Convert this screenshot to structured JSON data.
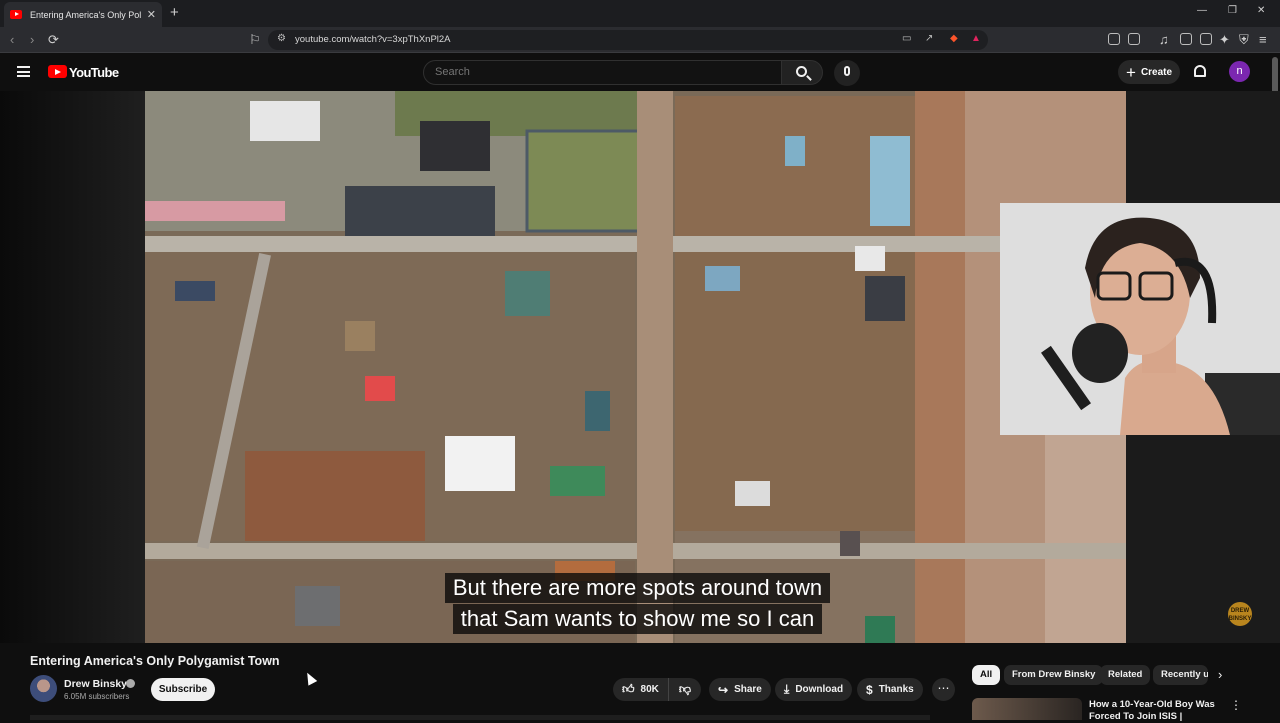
{
  "browser": {
    "tab_title": "Entering America's Only Polygamist Town",
    "tab_close": "✕",
    "new_tab": "+",
    "url": "youtube.com/watch?v=3xpThXnPl2A",
    "window_controls": [
      "—",
      "❐",
      "✕"
    ]
  },
  "masthead": {
    "logo_text": "YouTube",
    "search_placeholder": "Search",
    "create_label": "Create",
    "avatar_letter": "n"
  },
  "player": {
    "captions": [
      "But there are more spots around town",
      "that Sam wants to show me so I can"
    ],
    "watermark": "DREW BINSKY"
  },
  "video": {
    "title": "Entering America's Only Polygamist Town",
    "channel_name": "Drew Binsky",
    "subscribers": "6.05M subscribers",
    "subscribe_label": "Subscribe",
    "likes": "80K",
    "share_label": "Share",
    "download_label": "Download",
    "thanks_label": "Thanks",
    "more_label": "⋯"
  },
  "related": {
    "chips": [
      "All",
      "From Drew Binsky",
      "Related",
      "Recently u"
    ],
    "first_title": "How a 10-Year-Old Boy Was Forced To Join ISIS |"
  },
  "colors": {
    "background": "#0f0f0f",
    "brand_red": "#ff0000",
    "avatar_purple": "#7b27b0",
    "pill": "#272727"
  }
}
